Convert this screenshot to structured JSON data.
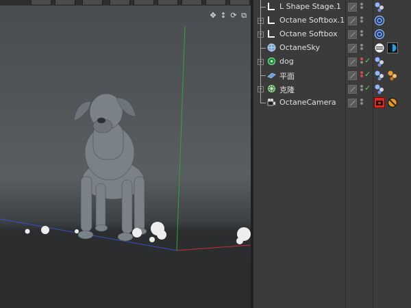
{
  "app": {
    "viewport_icons": [
      "move-view-icon",
      "pan-view-icon",
      "rotate-view-icon",
      "maximize-view-icon"
    ]
  },
  "objects": [
    {
      "name": "L Shape Stage.1",
      "icon": "lshape-icon",
      "tags": [
        "material-tag-icon"
      ]
    },
    {
      "name": "Octane Softbox.1",
      "icon": "lshape-icon",
      "tags": [
        "softbox-tag-icon"
      ]
    },
    {
      "name": "Octane Softbox",
      "icon": "lshape-icon",
      "tags": [
        "softbox-tag-icon"
      ]
    },
    {
      "name": "OctaneSky",
      "icon": "sky-sphere-icon",
      "tags": [
        "environment-tag-icon",
        "visibility-tag-icon"
      ]
    },
    {
      "name": "dog",
      "icon": "null-object-icon",
      "tags": [
        "material-tag-icon"
      ]
    },
    {
      "name": "平面",
      "icon": "plane-icon",
      "tags": [
        "material-tag-icon",
        "object-tag-icon"
      ]
    },
    {
      "name": "克隆",
      "icon": "cloner-icon",
      "tags": [
        "material-tag-icon"
      ]
    },
    {
      "name": "OctaneCamera",
      "icon": "camera-icon",
      "tags": [
        "camera-tag-icon",
        "protection-tag-icon"
      ]
    }
  ],
  "colors": {
    "panel_bg": "#3b3b3b",
    "text": "#e0e0e0",
    "check": "#5cd65c",
    "axis_x": "#c83232",
    "axis_y": "#2fa82f",
    "axis_z": "#3a4fc8"
  }
}
